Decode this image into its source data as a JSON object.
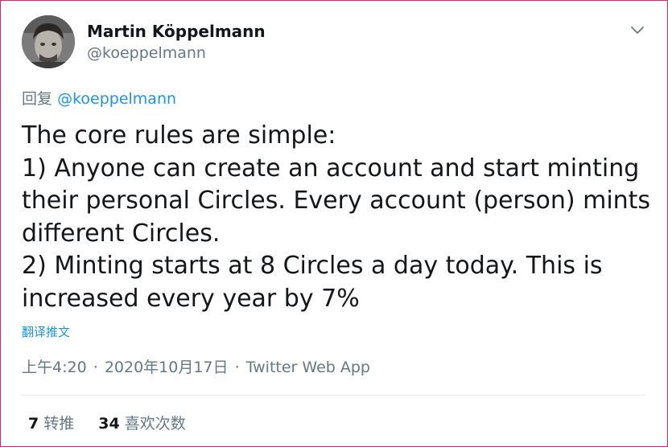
{
  "author": {
    "name": "Martin Köppelmann",
    "handle": "@koeppelmann"
  },
  "reply": {
    "prefix": "回复",
    "mention": "@koeppelmann"
  },
  "tweet": {
    "lines": [
      "The core rules are simple:",
      "1) Anyone can create an account and start minting",
      "their personal Circles. Every account (person) mints",
      "different Circles.",
      "2) Minting starts at 8 Circles a day today. This is",
      "increased every year by 7%"
    ],
    "translate_label": "翻译推文"
  },
  "meta": {
    "time": "上午4:20",
    "separator": "·",
    "date": "2020年10月17日",
    "source": "Twitter Web App"
  },
  "stats": {
    "retweets_count": "7",
    "retweets_label": "转推",
    "likes_count": "34",
    "likes_label": "喜欢次数"
  },
  "colors": {
    "text": "#14171a",
    "secondary": "#657786",
    "link": "#1b95e0",
    "divider": "#e6ecf0"
  },
  "icons": {
    "menu": "chevron-down-icon"
  }
}
